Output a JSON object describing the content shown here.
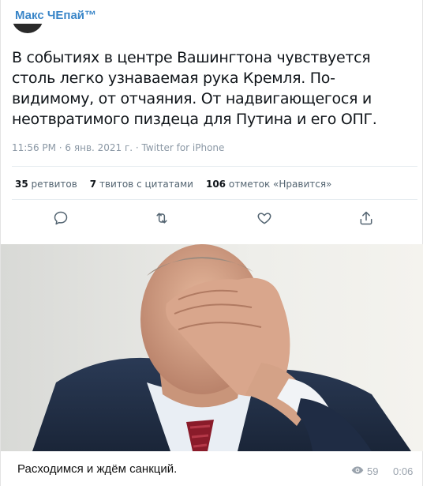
{
  "post": {
    "author": "Макс ЧЕпай™",
    "tweet_text": "В событиях в центре Вашингтона чувствуется столь легко узнаваемая рука Кремля. По-видимому, от отчаяния. От надвигающегося и неотвратимого пиздеца для Путина и его ОПГ.",
    "meta": "11:56 PM · 6 янв. 2021 г. · Twitter for iPhone",
    "stats": {
      "retweets_count": "35",
      "retweets_label": "ретвитов",
      "quotes_count": "7",
      "quotes_label": "твитов с цитатами",
      "likes_count": "106",
      "likes_label": "отметок «Нравится»"
    },
    "actions": [
      "reply-icon",
      "retweet-icon",
      "like-icon",
      "share-icon"
    ],
    "caption": "Расходимся и ждём санкций.",
    "views": "59",
    "time": "0:06"
  },
  "colors": {
    "author": "#3a86c8",
    "meta": "#8b98a5",
    "action_icon": "#536471",
    "footer_meta": "#9aa3ad"
  }
}
